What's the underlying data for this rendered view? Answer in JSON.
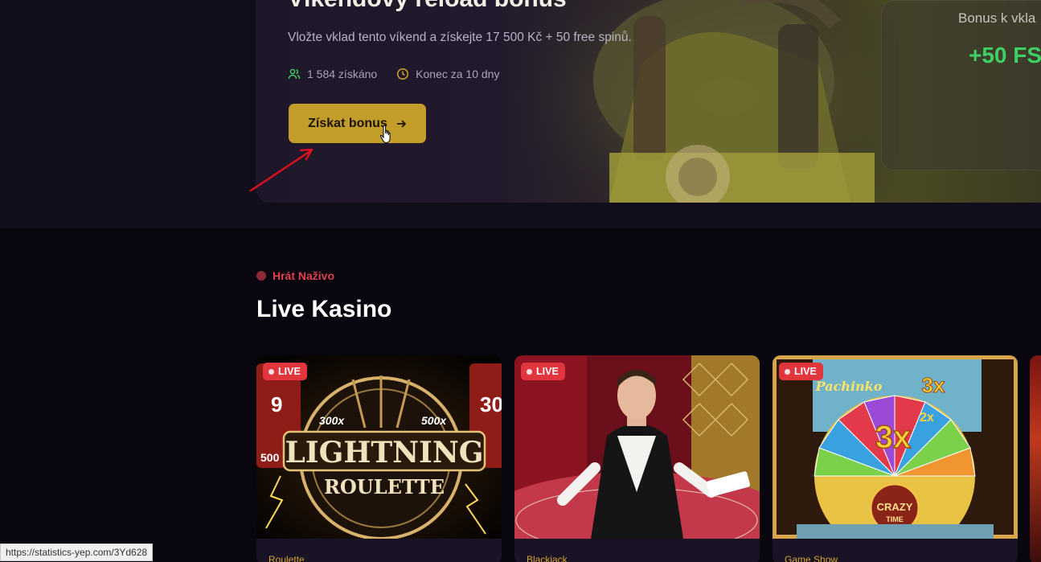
{
  "promo": {
    "title": "Víkendový reload bonus",
    "description": "Vložte vklad tento víkend a získejte 17 500 Kč + 50 free spinů.",
    "claimed": "1 584 získáno",
    "ends": "Konec za 10 dny",
    "cta_label": "Získat bonus",
    "bonus_amount": "17 500",
    "bonus_label": "Bonus k vkla",
    "free_spins": "+50 FS"
  },
  "live_section": {
    "tag": "Hrát Naživo",
    "title": "Live Kasino",
    "badge": "LIVE",
    "games": [
      {
        "category": "Roulette"
      },
      {
        "category": "Blackjack"
      },
      {
        "category": "Game Show"
      }
    ]
  },
  "status_bar": {
    "url": "https://statistics-yep.com/3Yd628"
  },
  "icons": {
    "claimed": "users-icon",
    "ends": "clock-icon",
    "cta": "arrow-right-icon",
    "cursor": "hand-pointer-icon",
    "annotation": "red-arrow-annotation"
  },
  "colors": {
    "accent_gold": "#c39d2a",
    "live_red": "#e2363f",
    "fs_green": "#3ecf64",
    "background": "#09060f"
  },
  "images": {
    "game_1_logo": [
      "LIGHTNING",
      "ROULETTE",
      "300x",
      "500x",
      "9",
      "30",
      "500"
    ],
    "game_3_logo": [
      "CRAZY",
      "TIME",
      "3x",
      "3x",
      "2x",
      "Pachinko"
    ]
  }
}
